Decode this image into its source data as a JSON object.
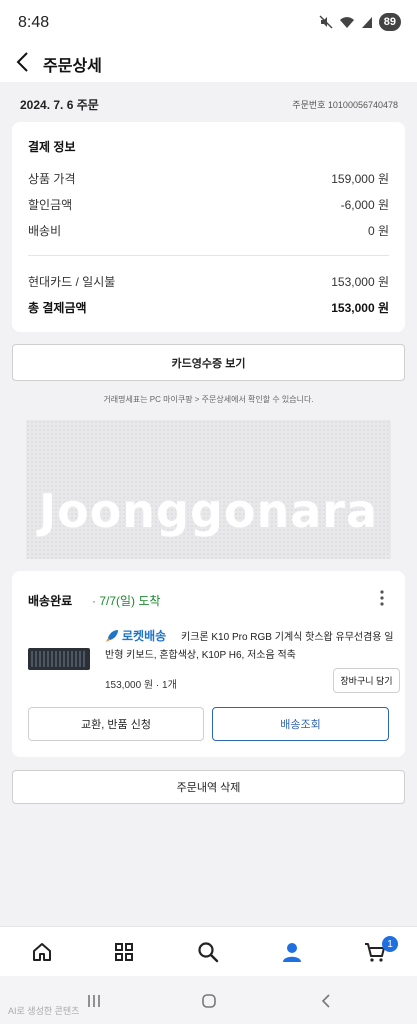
{
  "status_bar": {
    "time": "8:48",
    "battery": "89"
  },
  "header": {
    "title": "주문상세"
  },
  "order": {
    "date": "2024. 7. 6 주문",
    "number": "주문번호 10100056740478"
  },
  "payment": {
    "heading": "결제 정보",
    "rows": [
      {
        "label": "상품 가격",
        "value": "159,000 원"
      },
      {
        "label": "할인금액",
        "value": "-6,000 원"
      },
      {
        "label": "배송비",
        "value": "0 원"
      }
    ],
    "card_label": "현대카드 / 일시불",
    "card_value": "153,000 원",
    "total_label": "총 결제금액",
    "total_value": "153,000 원"
  },
  "receipt_button": "카드영수증 보기",
  "receipt_notice": "거래명세표는 PC 마이쿠팡 > 주문상세에서 확인할 수 있습니다.",
  "watermark": "Joonggonara",
  "shipment": {
    "status": "배송완료",
    "arrival": "· 7/7(일) 도착",
    "badge": "로켓배송",
    "product_name": "키크론 K10 Pro RGB 기계식 핫스왑 유무선겸용 일반형 키보드, 혼합색상, K10P H6, 저소음 적축",
    "price": "153,000 원 · 1개",
    "cart_button": "장바구니 담기",
    "exchange_button": "교환, 반품 신청",
    "track_button": "배송조회"
  },
  "delete_button": "주문내역 삭제",
  "bottom_nav": {
    "cart_badge": "1"
  },
  "footer_note": "AI로 생성한 콘텐츠"
}
